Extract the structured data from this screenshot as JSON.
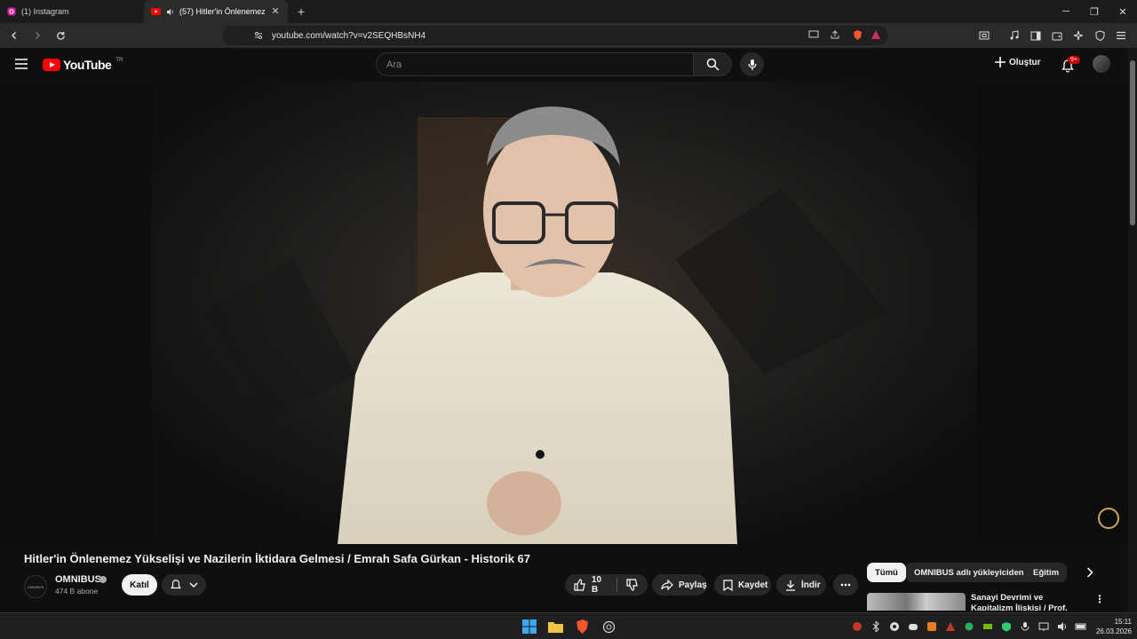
{
  "browser": {
    "tabs": [
      {
        "title": "(1) Instagram",
        "icon": "instagram-icon",
        "active": false
      },
      {
        "title": "(57) Hitler'in Önlenemez Yüks",
        "icon": "youtube-icon",
        "active": true
      }
    ],
    "new_tab_label": "+",
    "window_controls": {
      "minimize": "─",
      "restore": "❐",
      "close": "✕"
    },
    "url": "youtube.com/watch?v=v2SEQHBsNH4"
  },
  "youtube": {
    "logo_text": "YouTube",
    "country": "TR",
    "search_placeholder": "Ara",
    "create_label": "Oluştur",
    "notification_badge": "9+"
  },
  "video": {
    "title": "Hitler'in Önlenemez Yükselişi ve Nazilerin İktidara Gelmesi / Emrah Safa Gürkan - Historik 67",
    "channel": {
      "name": "OMNIBUS",
      "avatar_text": "OMNIBUS",
      "subscribers": "474 B abone"
    },
    "join_label": "Katıl",
    "likes": "10 B",
    "share_label": "Paylaş",
    "save_label": "Kaydet",
    "download_label": "İndir"
  },
  "sidebar": {
    "chips": [
      "Tümü",
      "OMNIBUS adlı yükleyiciden",
      "Eğitim"
    ],
    "recommendation": {
      "title": "Sanayi Devrimi ve Kapitalizm İlişkisi / Prof. Dr. Emrah Safa"
    }
  },
  "taskbar": {
    "time": "15:11",
    "date": "26.03.2026"
  },
  "colors": {
    "accent_red": "#ff0000",
    "background": "#0f0f0f",
    "surface": "#272727"
  }
}
